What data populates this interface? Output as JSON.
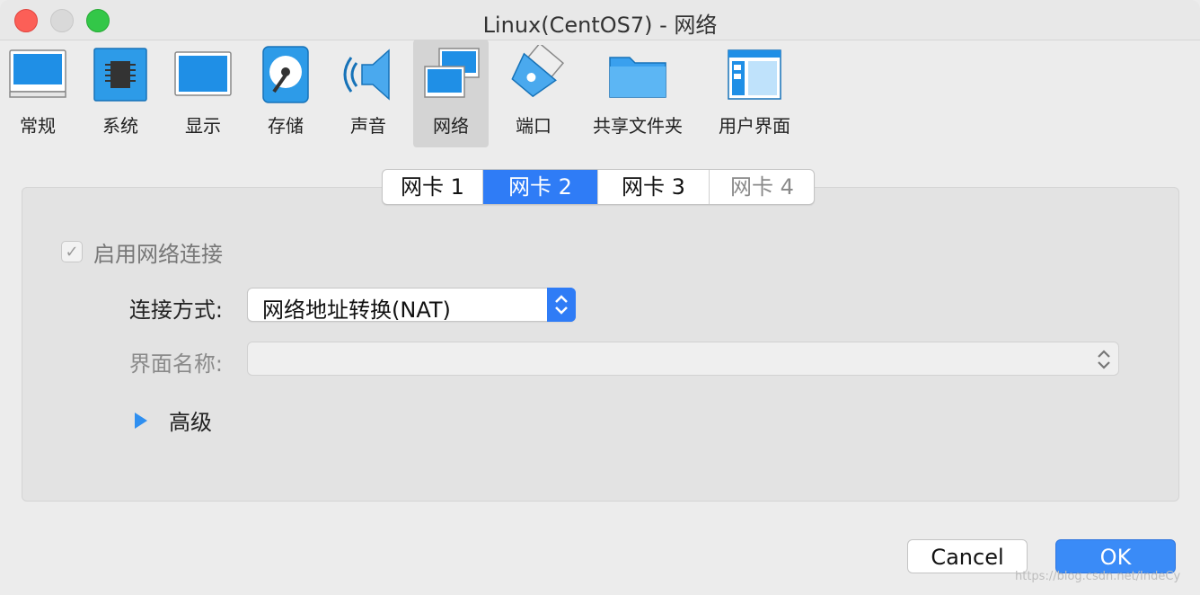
{
  "window": {
    "title": "Linux(CentOS7) - 网络"
  },
  "toolbar": {
    "items": [
      {
        "label": "常规",
        "icon": "monitor-icon"
      },
      {
        "label": "系统",
        "icon": "chip-icon"
      },
      {
        "label": "显示",
        "icon": "display-icon"
      },
      {
        "label": "存储",
        "icon": "storage-disk-icon"
      },
      {
        "label": "声音",
        "icon": "speaker-icon"
      },
      {
        "label": "网络",
        "icon": "network-icon",
        "selected": true
      },
      {
        "label": "端口",
        "icon": "serial-port-icon"
      },
      {
        "label": "共享文件夹",
        "icon": "shared-folder-icon"
      },
      {
        "label": "用户界面",
        "icon": "user-interface-icon"
      }
    ]
  },
  "tabs": [
    {
      "label": "网卡 1"
    },
    {
      "label": "网卡 2",
      "active": true
    },
    {
      "label": "网卡 3"
    },
    {
      "label": "网卡 4",
      "dim": true
    }
  ],
  "adapter": {
    "enable_label": "启用网络连接",
    "enabled": true,
    "attached_label": "连接方式:",
    "attached_value": "网络地址转换(NAT)",
    "name_label": "界面名称:",
    "name_value": "",
    "advanced_label": "高级"
  },
  "buttons": {
    "cancel": "Cancel",
    "ok": "OK"
  },
  "watermark": "https://blog.csdn.net/IndeCy",
  "colors": {
    "accent": "#2f7cf6",
    "close": "#fc5f57",
    "maximize": "#33c748"
  }
}
